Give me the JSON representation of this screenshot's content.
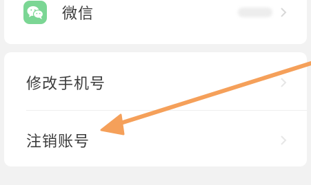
{
  "settings": {
    "wechat_label": "微信",
    "change_phone_label": "修改手机号",
    "delete_account_label": "注销账号"
  },
  "icons": {
    "wechat": "wechat-icon",
    "chevron": "chevron-right-icon",
    "annotation": "orange-arrow"
  },
  "colors": {
    "wechat_green": "#7bd694",
    "arrow_orange": "#f5a05a"
  }
}
